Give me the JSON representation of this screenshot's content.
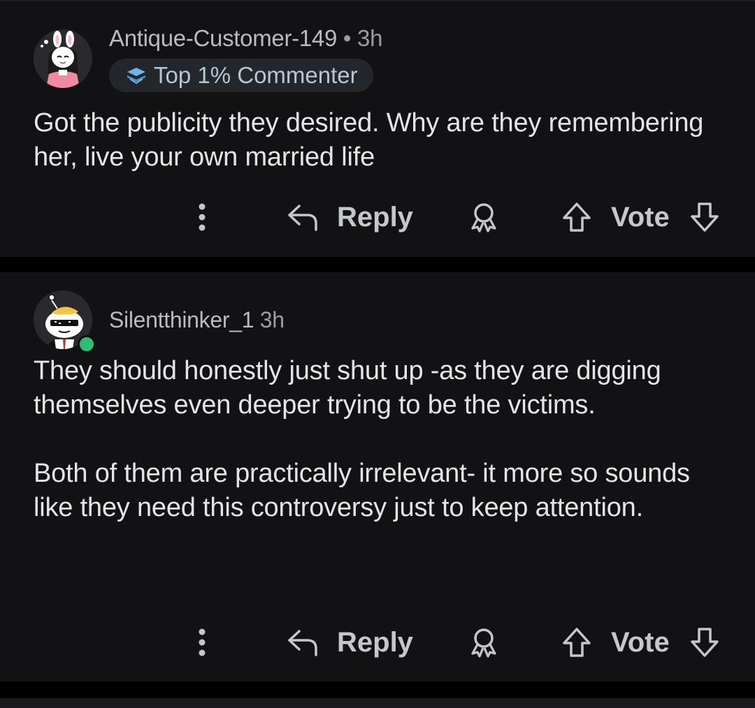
{
  "comments": [
    {
      "username": "Antique-Customer-149",
      "separator": "•",
      "time": "3h",
      "badge": "Top 1% Commenter",
      "body": [
        "Got the publicity they desired. Why are they remembering her, live your own married life"
      ],
      "actions": {
        "reply": "Reply",
        "vote": "Vote"
      }
    },
    {
      "username": "Silentthinker_1",
      "time": "3h",
      "online": true,
      "body": [
        "They should honestly just shut up -as they are digging themselves even deeper trying to be the victims.",
        "Both of them are practically irrelevant- it more so sounds like they need this controversy just to keep attention."
      ],
      "actions": {
        "reply": "Reply",
        "vote": "Vote"
      }
    }
  ],
  "icons": {
    "more": "kebab-icon",
    "reply": "reply-arrow-icon",
    "award": "award-icon",
    "upvote": "upvote-arrow-icon",
    "downvote": "downvote-arrow-icon",
    "badge": "top-commenter-icon"
  },
  "colors": {
    "background": "#121214",
    "separator": "#000000",
    "text": "#e3e5e7",
    "muted": "#9a9ea2",
    "badge_bg": "#23262b",
    "badge_icon": "#6fb6e8",
    "online": "#2fbf71"
  }
}
